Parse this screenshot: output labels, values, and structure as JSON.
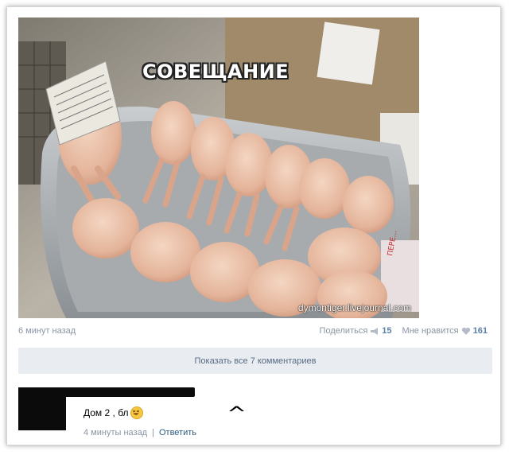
{
  "post": {
    "caption": "СОВЕЩАНИЕ",
    "watermark": "dymontiger.livejournal.com",
    "time": "6 минут назад",
    "share_label": "Поделиться",
    "share_count": "15",
    "like_label": "Мне нравится",
    "like_count": "161"
  },
  "comments": {
    "show_all_label": "Показать все 7 комментариев",
    "item": {
      "text": "Дом 2 , бл",
      "time": "4 минуты назад",
      "separator": "|",
      "reply_label": "Ответить",
      "annotation": "^"
    }
  },
  "icons": {
    "share": "megaphone-icon",
    "like": "heart-icon",
    "emoji": "laughing-emoji-icon"
  },
  "colors": {
    "link": "#5a7fab",
    "meta": "#8a94a3",
    "button_bg": "#e9edf1"
  }
}
